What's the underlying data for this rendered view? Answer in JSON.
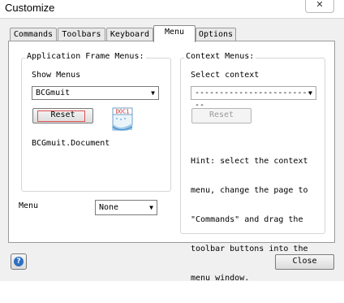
{
  "window": {
    "title": "Customize",
    "close_glyph": "✕"
  },
  "tabs": [
    {
      "label": "Commands",
      "active": false
    },
    {
      "label": "Toolbars",
      "active": false
    },
    {
      "label": "Keyboard",
      "active": false
    },
    {
      "label": "Menu",
      "active": true
    },
    {
      "label": "Options",
      "active": false
    }
  ],
  "app_menus": {
    "group_label": "Application Frame Menus:",
    "show_menus_label": "Show Menus",
    "show_menus_value": "BCGmuit",
    "reset_label": "Reset",
    "doc_icon_label": "DOC1",
    "document_label": "BCGmuit.Document"
  },
  "context_menus": {
    "group_label": "Context Menus:",
    "select_label": "Select context",
    "select_value": "--------------------------",
    "reset_label": "Reset",
    "hint_lines": [
      "Hint: select the context",
      "menu, change the page to",
      "\"Commands\" and drag the",
      "toolbar buttons into the",
      "menu window."
    ]
  },
  "menu_option": {
    "label": "Menu",
    "value": "None"
  },
  "footer": {
    "help_glyph": "?",
    "close_label": "Close"
  },
  "icons": {
    "dropdown": "chevron-down-icon",
    "help": "help-icon",
    "document": "document-icon"
  }
}
